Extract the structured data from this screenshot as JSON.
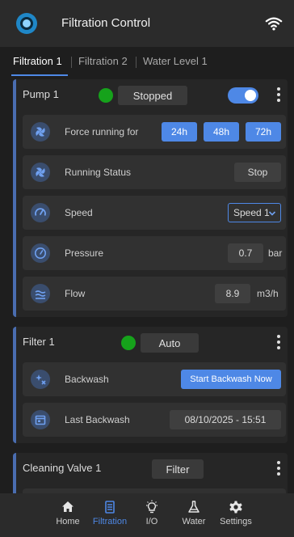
{
  "header": {
    "title": "Filtration Control",
    "wifi_icon": "wifi-icon",
    "logo_icon": "app-logo-icon"
  },
  "tabs": [
    {
      "label": "Filtration 1",
      "active": true
    },
    {
      "label": "Filtration 2",
      "active": false
    },
    {
      "label": "Water Level 1",
      "active": false
    }
  ],
  "pump": {
    "title": "Pump 1",
    "status": "Stopped",
    "status_color": "#16a21b",
    "toggle_on": true,
    "force_running": {
      "label": "Force running for",
      "options": [
        "24h",
        "48h",
        "72h"
      ]
    },
    "running_status": {
      "label": "Running Status",
      "button": "Stop"
    },
    "speed": {
      "label": "Speed",
      "value": "Speed 1"
    },
    "pressure": {
      "label": "Pressure",
      "value": "0.7",
      "unit": "bar"
    },
    "flow": {
      "label": "Flow",
      "value": "8.9",
      "unit": "m3/h"
    }
  },
  "filter": {
    "title": "Filter 1",
    "status": "Auto",
    "status_color": "#16a21b",
    "backwash": {
      "label": "Backwash",
      "button": "Start Backwash Now"
    },
    "last_backwash": {
      "label": "Last Backwash",
      "value": "08/10/2025 - 15:51"
    }
  },
  "valve": {
    "title": "Cleaning Valve 1",
    "status": "Filter"
  },
  "nav": [
    {
      "label": "Home",
      "icon": "home-icon",
      "active": false
    },
    {
      "label": "Filtration",
      "icon": "filtration-icon",
      "active": true
    },
    {
      "label": "I/O",
      "icon": "lightbulb-icon",
      "active": false
    },
    {
      "label": "Water",
      "icon": "flask-icon",
      "active": false
    },
    {
      "label": "Settings",
      "icon": "gear-icon",
      "active": false
    }
  ],
  "colors": {
    "accent": "#4e88e6",
    "card_border": "#4a6db0",
    "status_green": "#16a21b"
  }
}
